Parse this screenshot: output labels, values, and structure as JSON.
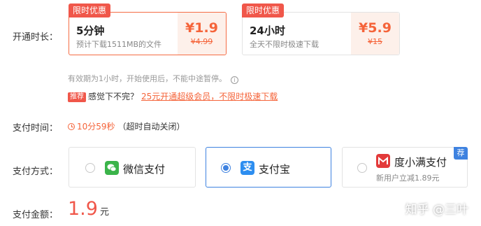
{
  "labels": {
    "duration": "开通时长：",
    "pay_time": "支付时间：",
    "pay_method": "支付方式：",
    "pay_amount": "支付金额："
  },
  "plans": [
    {
      "badge": "限时优惠",
      "name": "5分钟",
      "desc": "预计下载1511MB的文件",
      "price": "¥1.9",
      "old_price": "¥4.99",
      "selected": true
    },
    {
      "badge": "限时优惠",
      "name": "24小时",
      "desc": "全天不限时极速下载",
      "price": "¥5.9",
      "old_price": "¥15",
      "selected": false
    }
  ],
  "validity_note": "有效期为1小时，开始使用后，不能中途暂停。",
  "validity_icon": "i",
  "promo": {
    "tag": "推荐",
    "text": "感觉下不完？",
    "link": "25元开通超级会员，不限时极速下载"
  },
  "countdown": {
    "time": "10分59秒",
    "note": "（超时自动关闭）"
  },
  "payment_methods": [
    {
      "label": "微信支付",
      "icon": "wechat-icon",
      "icon_color": "#3bb44a",
      "selected": false
    },
    {
      "label": "支付宝",
      "icon": "alipay-icon",
      "icon_color": "#2d8ef0",
      "icon_glyph": "支",
      "selected": true
    },
    {
      "label": "度小满支付",
      "icon": "duxiaoman-icon",
      "icon_color": "#e33a3a",
      "sub": "新用户立减1.89元",
      "corner": "荐",
      "selected": false
    }
  ],
  "amount": {
    "value": "1.9",
    "unit": "元"
  },
  "watermark": "知乎 @三叶"
}
